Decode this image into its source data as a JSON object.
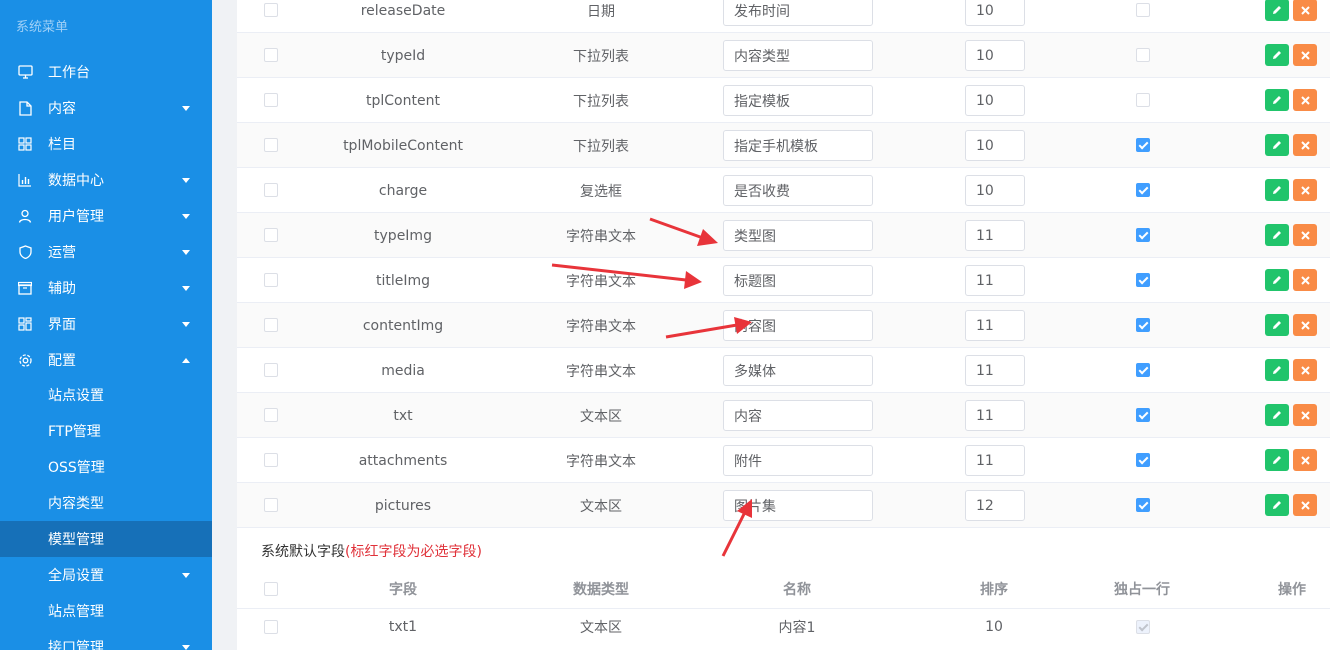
{
  "sidebar": {
    "menu_title": "系统菜单",
    "items": [
      {
        "label": "工作台",
        "icon": "monitor-icon",
        "caret": ""
      },
      {
        "label": "内容",
        "icon": "document-icon",
        "caret": "down"
      },
      {
        "label": "栏目",
        "icon": "grid-icon",
        "caret": ""
      },
      {
        "label": "数据中心",
        "icon": "bar-chart-icon",
        "caret": "down"
      },
      {
        "label": "用户管理",
        "icon": "user-icon",
        "caret": "down"
      },
      {
        "label": "运营",
        "icon": "shield-icon",
        "caret": "down"
      },
      {
        "label": "辅助",
        "icon": "box-icon",
        "caret": "down"
      },
      {
        "label": "界面",
        "icon": "layout-icon",
        "caret": "down"
      },
      {
        "label": "配置",
        "icon": "gear-icon",
        "caret": "up"
      }
    ],
    "sub_items": [
      {
        "label": "站点设置",
        "active": false
      },
      {
        "label": "FTP管理",
        "active": false
      },
      {
        "label": "OSS管理",
        "active": false
      },
      {
        "label": "内容类型",
        "active": false
      },
      {
        "label": "模型管理",
        "active": true
      },
      {
        "label": "全局设置",
        "active": false,
        "caret": "down"
      },
      {
        "label": "站点管理",
        "active": false
      },
      {
        "label": "接口管理",
        "active": false,
        "caret": "down"
      }
    ]
  },
  "fields": [
    {
      "field": "releaseDate",
      "type": "日期",
      "name": "发布时间",
      "order": "10",
      "own_line": false
    },
    {
      "field": "typeId",
      "type": "下拉列表",
      "name": "内容类型",
      "order": "10",
      "own_line": false
    },
    {
      "field": "tplContent",
      "type": "下拉列表",
      "name": "指定模板",
      "order": "10",
      "own_line": false
    },
    {
      "field": "tplMobileContent",
      "type": "下拉列表",
      "name": "指定手机模板",
      "order": "10",
      "own_line": true
    },
    {
      "field": "charge",
      "type": "复选框",
      "name": "是否收费",
      "order": "10",
      "own_line": true
    },
    {
      "field": "typeImg",
      "type": "字符串文本",
      "name": "类型图",
      "order": "11",
      "own_line": true
    },
    {
      "field": "titleImg",
      "type": "字符串文本",
      "name": "标题图",
      "order": "11",
      "own_line": true
    },
    {
      "field": "contentImg",
      "type": "字符串文本",
      "name": "内容图",
      "order": "11",
      "own_line": true
    },
    {
      "field": "media",
      "type": "字符串文本",
      "name": "多媒体",
      "order": "11",
      "own_line": true
    },
    {
      "field": "txt",
      "type": "文本区",
      "name": "内容",
      "order": "11",
      "own_line": true
    },
    {
      "field": "attachments",
      "type": "字符串文本",
      "name": "附件",
      "order": "11",
      "own_line": true
    },
    {
      "field": "pictures",
      "type": "文本区",
      "name": "图片集",
      "order": "12",
      "own_line": true
    }
  ],
  "system_section": {
    "title": "系统默认字段",
    "note": "(标红字段为必选字段)"
  },
  "system_table": {
    "headers": [
      "字段",
      "数据类型",
      "名称",
      "排序",
      "独占一行",
      "操作"
    ],
    "rows": [
      {
        "field": "txt1",
        "type": "文本区",
        "name": "内容1",
        "order": "10",
        "own_line": true
      }
    ]
  },
  "colors": {
    "sidebar": "#1a8fe6",
    "sidebar_active": "#1670b8",
    "edit_button": "#21c46b",
    "delete_button": "#f98b46",
    "checkbox_checked": "#409eff",
    "arrow": "#e8343a"
  }
}
